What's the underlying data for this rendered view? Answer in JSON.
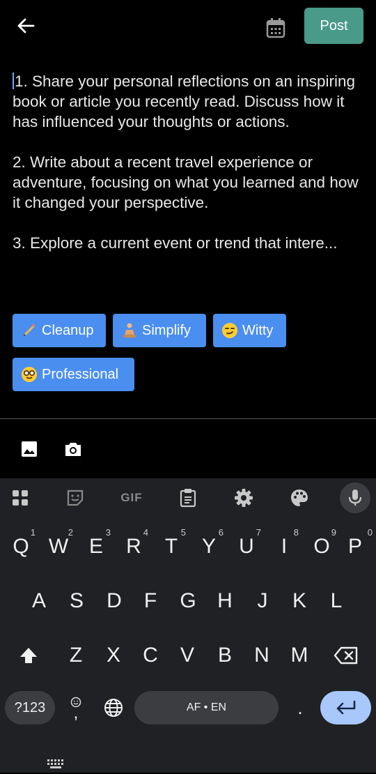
{
  "header": {
    "post_label": "Post",
    "back_icon": "arrow-left-icon",
    "calendar_icon": "calendar-icon"
  },
  "editor": {
    "paragraphs": [
      "1. Share your personal reflections on an inspiring book or article you recently read. Discuss how it has influenced your thoughts or actions.",
      "2. Write about a recent travel experience or adventure, focusing on what you learned and how it changed your perspective.",
      "3. Explore a current event or trend that intere..."
    ]
  },
  "chips": {
    "cleanup": "Cleanup",
    "simplify": "Simplify",
    "witty": "Witty",
    "professional": "Professional"
  },
  "media": {
    "image_icon": "image-icon",
    "camera_icon": "camera-icon"
  },
  "keyboard": {
    "toolbar": [
      "apps-icon",
      "sticker-icon",
      "GIF",
      "clipboard-icon",
      "settings-icon",
      "palette-icon",
      "mic-icon"
    ],
    "row1": [
      "Q",
      "W",
      "E",
      "R",
      "T",
      "Y",
      "U",
      "I",
      "O",
      "P"
    ],
    "row1_hints": [
      "1",
      "2",
      "3",
      "4",
      "5",
      "6",
      "7",
      "8",
      "9",
      "0"
    ],
    "row2": [
      "A",
      "S",
      "D",
      "F",
      "G",
      "H",
      "J",
      "K",
      "L"
    ],
    "row3": [
      "Z",
      "X",
      "C",
      "V",
      "B",
      "N",
      "M"
    ],
    "symbols_label": "?123",
    "comma": ",",
    "space_label": "AF • EN",
    "period": ".",
    "enter_color": "#a8c7fa",
    "accent": "#4a9a8a",
    "chip_color": "#4a8ef0"
  }
}
